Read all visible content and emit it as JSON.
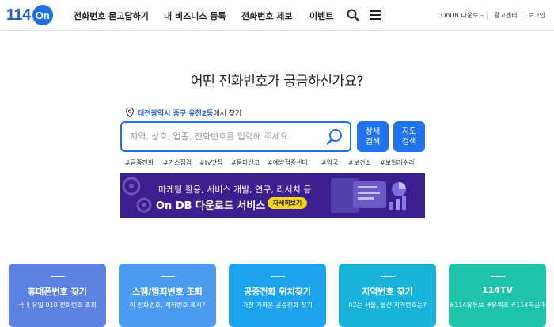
{
  "header": {
    "logo_number": "114",
    "logo_badge": "On",
    "nav": [
      {
        "label": "전화번호 묻고답하기"
      },
      {
        "label": "내 비즈니스 등록"
      },
      {
        "label": "전화번호 제보"
      },
      {
        "label": "이벤트"
      }
    ],
    "utility": [
      {
        "label": "OnDB 다운로드"
      },
      {
        "label": "광고센터"
      },
      {
        "label": "로그인"
      }
    ]
  },
  "main": {
    "headline": "어떤 전화번호가 궁금하신가요?",
    "location": {
      "link": "대전광역시 중구 유천2동",
      "suffix": "에서 찾기"
    },
    "search": {
      "placeholder": "지역, 상호, 업종, 전화번호를 입력해 주세요.",
      "value": ""
    },
    "detail_search_btn": {
      "line1": "상세",
      "line2": "검색"
    },
    "map_search_btn": {
      "line1": "지도",
      "line2": "검색"
    },
    "tags": [
      "#공중전화",
      "#가스점검",
      "#tv맛집",
      "#동파신고",
      "#예방접종센터",
      "#약국",
      "#보건소",
      "#보일러수리"
    ]
  },
  "banner": {
    "line1": "마케팅 활용, 서비스 개발, 연구, 리서치 등",
    "line2": "On DB 다운로드 서비스",
    "cta": "자세히보기",
    "bg_color": "#3b1f8e"
  },
  "cards": [
    {
      "title": "휴대폰번호 찾기",
      "sub": "국내 유일 010 전화번호 조회",
      "color": "#5b82e0"
    },
    {
      "title": "스팸/범죄번호 조회",
      "sub": "이 전화번호, 계좌번호 혹시?",
      "color": "#4b9cf0"
    },
    {
      "title": "공중전화 위치찾기",
      "sub": "가장 가까운 공중전화 찾기",
      "color": "#1ca3ee"
    },
    {
      "title": "지역번호 찾기",
      "sub": "02는 서울, 울산 지역번호는?",
      "color": "#19b2d8"
    },
    {
      "title": "114TV",
      "sub": "#114유튜브 #유퀴즈 #114특공대",
      "color": "#1fc3aa"
    }
  ],
  "colors": {
    "brand_blue": "#1f6fe5",
    "cta_yellow": "#f7d31e"
  },
  "icons": {
    "search": "search-icon",
    "menu": "hamburger-menu-icon",
    "location": "location-pin-icon"
  }
}
